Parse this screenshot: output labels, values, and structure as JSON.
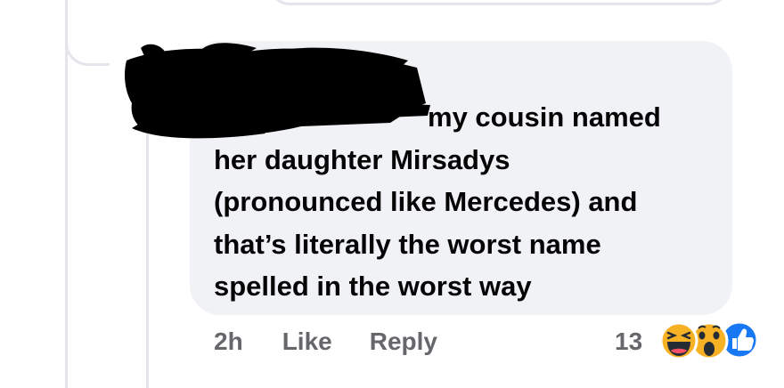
{
  "comment": {
    "text_lines": [
      "my cousin named",
      "her daughter Mirsadys",
      "(pronounced like Mercedes) and",
      "that’s literally the worst name",
      "spelled in the worst way"
    ],
    "time": "2h",
    "like_label": "Like",
    "reply_label": "Reply",
    "reaction_count": "13",
    "reactions": [
      "haha-icon",
      "wow-icon",
      "like-icon"
    ]
  }
}
